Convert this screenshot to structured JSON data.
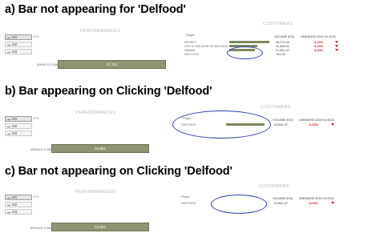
{
  "sections": [
    {
      "title": "a) Bar not appearing for 'Delfood'"
    },
    {
      "title": "b) Bar appearing on Clicking 'Delfood'"
    },
    {
      "title": "c) Bar not appearing on Clicking 'Delfood'"
    }
  ],
  "labels": {
    "performances": "PERFORMANCES",
    "customers": "CUSTOMERS",
    "player": "Player",
    "volume_col": "VOLUME (KG)",
    "variance_col": "VARIANCE 2016 Vs 2015",
    "perf_left": "ARNALD COMPE",
    "perf_value": "37,761",
    "perf_value_b": "24,861",
    "fyl": "FYL"
  },
  "slicer_items": [
    "M1",
    "M2",
    "M3"
  ],
  "panel_a": {
    "customers": [
      {
        "name": "MEHRIT",
        "volume": "38,274,34",
        "variance": "-9,10%"
      },
      {
        "name": "CRU & HUILERIE DE BELOUDI",
        "volume": "22,665,91",
        "variance": "-9,10%"
      },
      {
        "name": "HANAN",
        "volume": "21,861,47",
        "variance": "-3,10%"
      },
      {
        "name": "DELFOOD",
        "volume": "781,28",
        "variance": ""
      }
    ]
  },
  "panel_b": {
    "customers": [
      {
        "name": "DELFOOD",
        "volume": "24,861,47",
        "variance": "-6,03%"
      }
    ]
  },
  "panel_c": {
    "customers": [
      {
        "name": "DELFOOD",
        "volume": "24,861,47",
        "variance": "-6,03%"
      }
    ]
  },
  "colors": {
    "bar": "#8f9472",
    "ellipse": "#2b3fa8",
    "negative": "#d21f1f"
  }
}
